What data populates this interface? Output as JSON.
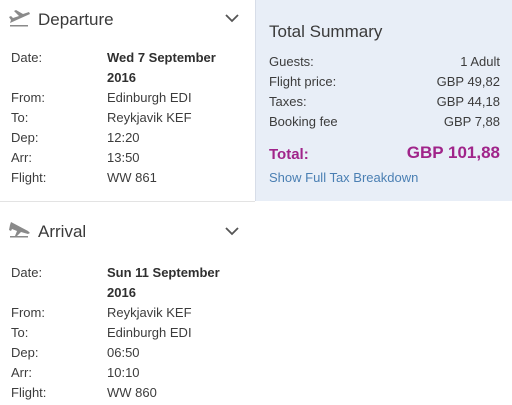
{
  "departure": {
    "title": "Departure",
    "plane_icon": "plane-takeoff-icon",
    "toggle_icon": "chevron-down-icon",
    "rows": [
      {
        "label": "Date:",
        "value": "Wed 7 September",
        "bold": true
      },
      {
        "label": "",
        "value": "2016",
        "bold": true
      },
      {
        "label": "From:",
        "value": "Edinburgh EDI"
      },
      {
        "label": "To:",
        "value": "Reykjavik KEF"
      },
      {
        "label": "Dep:",
        "value": "12:20"
      },
      {
        "label": "Arr:",
        "value": "13:50"
      },
      {
        "label": "Flight:",
        "value": "WW 861"
      }
    ]
  },
  "arrival": {
    "title": "Arrival",
    "plane_icon": "plane-landing-icon",
    "toggle_icon": "chevron-down-icon",
    "rows": [
      {
        "label": "Date:",
        "value": "Sun 11 September",
        "bold": true
      },
      {
        "label": "",
        "value": "2016",
        "bold": true
      },
      {
        "label": "From:",
        "value": "Reykjavik KEF"
      },
      {
        "label": "To:",
        "value": "Edinburgh EDI"
      },
      {
        "label": "Dep:",
        "value": "06:50"
      },
      {
        "label": "Arr:",
        "value": "10:10"
      },
      {
        "label": "Flight:",
        "value": "WW 860"
      }
    ]
  },
  "summary": {
    "title": "Total Summary",
    "rows": [
      {
        "label": "Guests:",
        "value": "1 Adult"
      },
      {
        "label": "Flight price:",
        "value": "GBP 49,82"
      },
      {
        "label": "Taxes:",
        "value": "GBP 44,18"
      },
      {
        "label": "Booking fee",
        "value": "GBP 7,88"
      }
    ],
    "total_label": "Total:",
    "total_value": "GBP 101,88",
    "tax_link": "Show Full Tax Breakdown"
  },
  "colors": {
    "summary_bg": "#e8eef7",
    "total": "#a0248a",
    "link": "#4a7fb3"
  }
}
